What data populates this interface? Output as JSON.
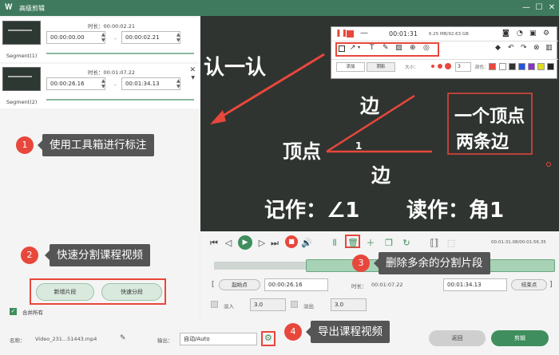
{
  "window": {
    "title": "高级剪辑",
    "logo": "𝐖",
    "min": "—",
    "max": "☐",
    "close": "✕"
  },
  "segments": [
    {
      "name": "Segment(1)",
      "duration_label": "时长：00:00:02.21",
      "start": "00:00:00.00",
      "end": "00:00:02.21"
    },
    {
      "name": "Segment(2)",
      "duration_label": "时长：00:01:07.22",
      "start": "00:00:26.16",
      "end": "00:01:34.13"
    }
  ],
  "callouts": [
    {
      "num": "1",
      "text": "使用工具箱进行标注"
    },
    {
      "num": "2",
      "text": "快速分割课程视频"
    },
    {
      "num": "3",
      "text": "删除多余的分割片段"
    },
    {
      "num": "4",
      "text": "导出课程视频"
    }
  ],
  "left_buttons": {
    "add_segment": "新增片段",
    "quick_split": "快速分段"
  },
  "merge_all": "合并所有",
  "video_text": {
    "top_left": "认一认",
    "edge_top": "边",
    "vertex": "顶点",
    "one": "1",
    "edge_bottom": "边",
    "box_line1": "一个顶点",
    "box_line2": "两条边",
    "notation": "记作：∠1",
    "reading": "读作：角1"
  },
  "annot_toolbar": {
    "time": "00:01:31",
    "size": "6.25 MB/92.63 GB",
    "tab_add": "添加",
    "tab_properties": "阴影",
    "size_label": "大小：",
    "size_value": "3",
    "color_label": "颜色：",
    "palette": [
      "#e8473c",
      "#ffffff",
      "#333333",
      "#2255dd",
      "#8833cc",
      "#dddd22",
      "#222222"
    ]
  },
  "player": {
    "time_readout": "00:01:31.08/00:01:56.35"
  },
  "clip": {
    "start_btn": "起始点",
    "start_value": "00:00:26.16",
    "duration_label": "时长：",
    "duration_value": "00:01:07.22",
    "end_value": "00:01:34.13",
    "end_btn": "结束点",
    "fade_in_label": "淡入",
    "fade_in_value": "3.0",
    "fade_out_label": "淡出",
    "fade_out_value": "3.0"
  },
  "bottom": {
    "name_label": "名称：",
    "filename": "Video_231...51443.mp4",
    "output_label": "输出：",
    "output_value": "自动/Auto",
    "back_btn": "返回",
    "cut_btn": "剪辑"
  },
  "colors": {
    "accent": "#3f7a5e",
    "highlight": "#e8473c",
    "cut_button": "#3f8e5d"
  }
}
